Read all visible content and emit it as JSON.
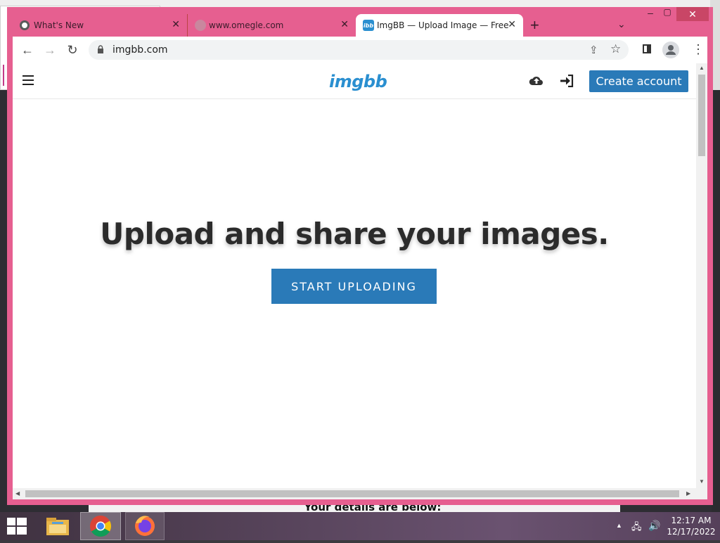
{
  "tabs": [
    {
      "label": "What's New",
      "active": false,
      "favicon": "chrome-icon"
    },
    {
      "label": "www.omegle.com",
      "active": false,
      "favicon": "globe-icon"
    },
    {
      "label": "ImgBB — Upload Image — Free",
      "active": true,
      "favicon": "imgbb-icon",
      "favicon_text": "ibb"
    }
  ],
  "toolbar": {
    "url": "imgbb.com",
    "new_tab": "+",
    "close_glyph": "✕"
  },
  "site": {
    "logo": "imgbb",
    "create_account": "Create account",
    "hero_title": "Upload and share your images.",
    "start_uploading": "START UPLOADING",
    "brand_color": "#2a7ab8"
  },
  "background": {
    "behind_text": "Your details are below:"
  },
  "taskbar": {
    "time": "12:17 AM",
    "date": "12/17/2022"
  },
  "colors": {
    "window_frame": "#e65f90",
    "close_button": "#c94666"
  }
}
